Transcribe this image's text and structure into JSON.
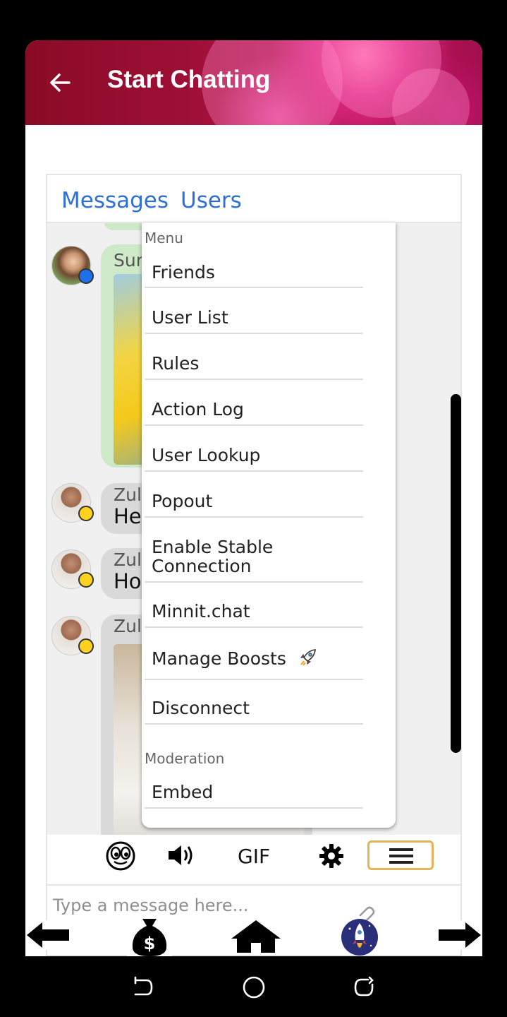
{
  "header": {
    "title": "Start Chatting"
  },
  "tabs": [
    {
      "label": "Messages"
    },
    {
      "label": "Users"
    }
  ],
  "messages": [
    {
      "name": "Sun",
      "text": ""
    },
    {
      "name": "Zul",
      "text": "He"
    },
    {
      "name": "Zul",
      "text": "Ho"
    },
    {
      "name": "Zul",
      "text": ""
    }
  ],
  "menu": {
    "section_menu": "Menu",
    "items": [
      {
        "label": "Friends"
      },
      {
        "label": "User List"
      },
      {
        "label": "Rules"
      },
      {
        "label": "Action Log"
      },
      {
        "label": "User Lookup"
      },
      {
        "label": "Popout"
      },
      {
        "label": "Enable Stable Connection"
      },
      {
        "label": "Minnit.chat"
      },
      {
        "label": "Manage Boosts"
      },
      {
        "label": "Disconnect"
      }
    ],
    "section_moderation": "Moderation",
    "moderation_items": [
      {
        "label": "Embed"
      }
    ]
  },
  "toolbar": {
    "gif_label": "GIF"
  },
  "input": {
    "placeholder": "Type a message here..."
  },
  "colors": {
    "accent": "#2f6fd6",
    "header": "#9e0f35",
    "online_blue": "#1e6fe8",
    "away_yellow": "#ffd21f",
    "toggle_border": "#e6b35a"
  }
}
